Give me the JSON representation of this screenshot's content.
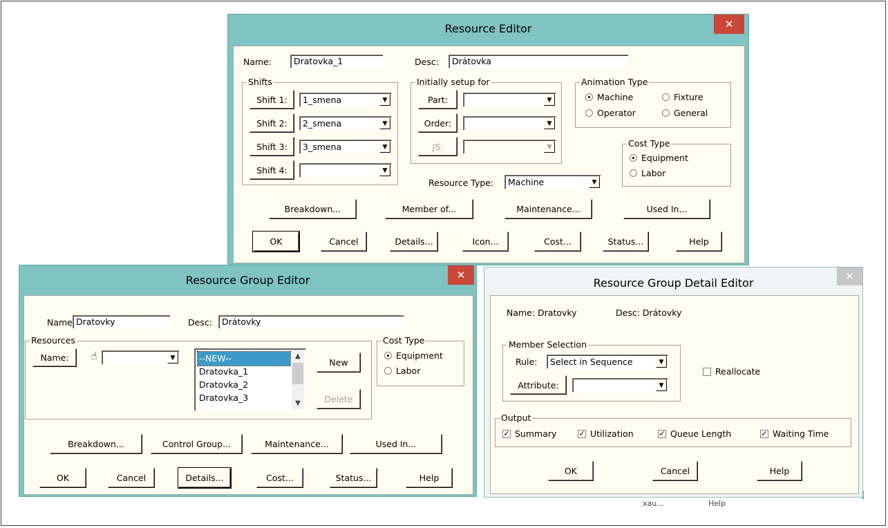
{
  "resource_editor": {
    "title": "Resource Editor",
    "name_label": "Name:",
    "name_value": "Dratovka_1",
    "desc_label": "Desc:",
    "desc_value": "Drátovka",
    "shifts_caption": "Shifts",
    "shifts": [
      {
        "button": "Shift 1:",
        "value": "1_smena"
      },
      {
        "button": "Shift 2:",
        "value": "2_smena"
      },
      {
        "button": "Shift 3:",
        "value": "3_smena"
      },
      {
        "button": "Shift 4:",
        "value": ""
      }
    ],
    "setup_caption": "Initially setup for",
    "setup": [
      {
        "button": "Part:",
        "value": "",
        "enabled": true
      },
      {
        "button": "Order:",
        "value": "",
        "enabled": true
      },
      {
        "button": "JS:",
        "value": "",
        "enabled": false
      }
    ],
    "animation_caption": "Animation Type",
    "animation_options": [
      "Machine",
      "Fixture",
      "Operator",
      "General"
    ],
    "animation_selected": "Machine",
    "cost_caption": "Cost Type",
    "cost_options": [
      "Equipment",
      "Labor"
    ],
    "cost_selected": "Equipment",
    "resource_type_label": "Resource Type:",
    "resource_type_value": "Machine",
    "row1_buttons": [
      "Breakdown...",
      "Member of...",
      "Maintenance...",
      "Used In..."
    ],
    "row2_buttons": [
      "OK",
      "Cancel",
      "Details...",
      "Icon...",
      "Cost...",
      "Status...",
      "Help"
    ]
  },
  "group_editor": {
    "title": "Resource Group Editor",
    "name_label": "Name:",
    "name_value": "Dratovky",
    "desc_label": "Desc:",
    "desc_value": "Drátovky",
    "resources_caption": "Resources",
    "name_button": "Name:",
    "resource_combo_value": "",
    "list_items": [
      "--NEW--",
      "Dratovka_1",
      "Dratovka_2",
      "Dratovka_3"
    ],
    "list_selected": "--NEW--",
    "new_button": "New",
    "delete_button": "Delete",
    "cost_caption": "Cost Type",
    "cost_options": [
      "Equipment",
      "Labor"
    ],
    "cost_selected": "Equipment",
    "row1_buttons": [
      "Breakdown...",
      "Control Group...",
      "Maintenance...",
      "Used In..."
    ],
    "row2_buttons": [
      "OK",
      "Cancel",
      "Details...",
      "Cost...",
      "Status...",
      "Help"
    ]
  },
  "detail_editor": {
    "title": "Resource Group Detail Editor",
    "name_text": "Name: Dratovky",
    "desc_text": "Desc: Drátovky",
    "member_caption": "Member Selection",
    "rule_label": "Rule:",
    "rule_value": "Select in Sequence",
    "attribute_button": "Attribute:",
    "attribute_value": "",
    "reallocate_label": "Reallocate",
    "reallocate_checked": false,
    "output_caption": "Output",
    "output_options": [
      {
        "label": "Summary",
        "checked": true
      },
      {
        "label": "Utilization",
        "checked": true
      },
      {
        "label": "Queue Length",
        "checked": true
      },
      {
        "label": "Waiting Time",
        "checked": true
      }
    ],
    "buttons": [
      "OK",
      "Cancel",
      "Help"
    ]
  },
  "background_fragments": {
    "left": "xau...",
    "right": "Help"
  },
  "colors": {
    "titlebar": "#7fc3c2",
    "client_bg": "#fffdf0",
    "close_red": "#c9483a",
    "selection": "#3c9ac9"
  },
  "icons": {
    "close": "close-icon",
    "dropdown": "chevron-down-icon",
    "pointer": "hand-pointer-icon"
  }
}
